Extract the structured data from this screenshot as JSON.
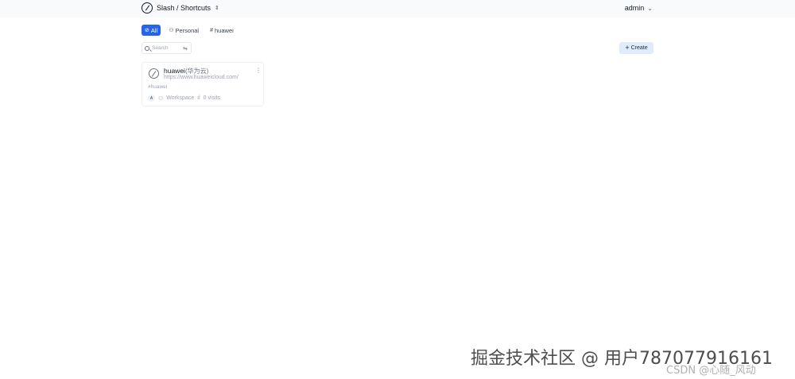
{
  "header": {
    "brand_title": "Slash / Shortcuts",
    "brand_chevron": "⇕",
    "user_name": "admin",
    "user_chevron": "⌄"
  },
  "filters": [
    {
      "icon": "⊘",
      "label": "All",
      "active": true
    },
    {
      "icon": "⚇",
      "label": "Personal",
      "active": false
    },
    {
      "icon": "#",
      "label": "huawei",
      "active": false
    }
  ],
  "search": {
    "placeholder": "Search",
    "value": ""
  },
  "toolbar": {
    "create_label": "Create",
    "create_icon": "+"
  },
  "shortcuts": [
    {
      "title": "huawei",
      "alt_title": "(华为云)",
      "url": "https://www.huaweicloud.com/",
      "tag": "#huawei",
      "avatar": "A",
      "visibility": "Workspace",
      "visits": "0 visits"
    }
  ],
  "watermark": {
    "main": "掘金技术社区 @ 用户787077916161",
    "sub": "CSDN @心随_风动"
  },
  "colors": {
    "accent": "#2563eb",
    "create_bg": "#e0ecfb",
    "topbar_bg": "#f9fafb"
  }
}
